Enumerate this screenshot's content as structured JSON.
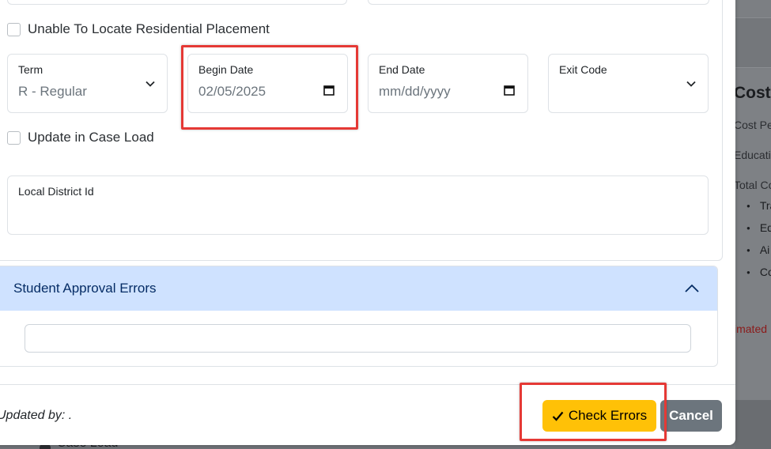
{
  "background": {
    "costs_title": "Costs",
    "lines": [
      "Cost Pe",
      "Educati",
      "Total Co"
    ],
    "bullets": [
      "Tra",
      "Ed",
      "Ai",
      "Co"
    ],
    "estimated_text": "imated",
    "case_load_text": "Case Load"
  },
  "form": {
    "unable_placement_label": "Unable To Locate Residential Placement",
    "term": {
      "label": "Term",
      "value": "R - Regular"
    },
    "begin_date": {
      "label": "Begin Date",
      "value": "02/05/2025"
    },
    "end_date": {
      "label": "End Date",
      "value": "mm/dd/yyyy"
    },
    "exit_code": {
      "label": "Exit Code",
      "value": ""
    },
    "update_caseload_label": "Update in Case Load",
    "local_district": {
      "label": "Local District Id",
      "value": ""
    }
  },
  "accordion": {
    "title": "Student Approval Errors",
    "input_value": ""
  },
  "footer": {
    "updated_by_label": "Updated by: .",
    "check_errors_label": "Check Errors",
    "cancel_label": "Cancel"
  },
  "icons": {
    "check": "check-icon",
    "chevron_down": "chevron-down-icon",
    "chevron_up": "chevron-up-icon",
    "calendar": "calendar-icon"
  },
  "colors": {
    "accent_yellow": "#ffc107",
    "cancel_gray": "#6c757d",
    "accordion_bg": "#cfe2ff",
    "highlight_red": "#e53935"
  }
}
